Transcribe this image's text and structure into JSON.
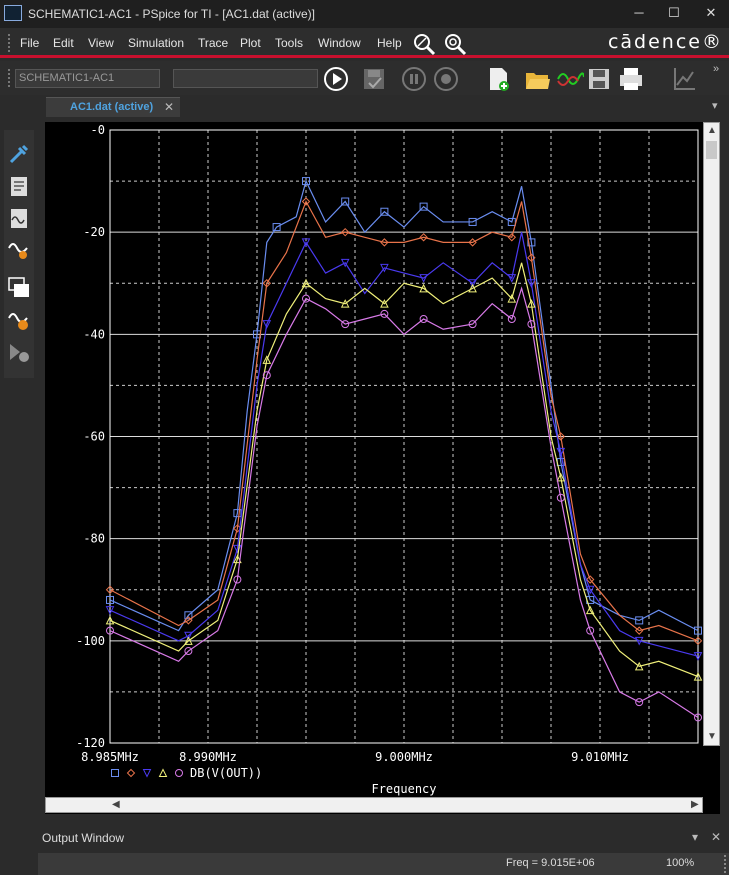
{
  "window": {
    "title": "SCHEMATIC1-AC1 - PSpice for TI - [AC1.dat (active)]",
    "minimize": "─",
    "maximize": "☐",
    "close": "✕"
  },
  "menu": {
    "items": [
      "File",
      "Edit",
      "View",
      "Simulation",
      "Trace",
      "Plot",
      "Tools",
      "Window",
      "Help"
    ],
    "brand": "cādence®"
  },
  "toolbar": {
    "profile_value": "SCHEMATIC1-AC1",
    "second_field_value": ""
  },
  "tabs": [
    {
      "label": "AC1.dat (active)",
      "close": "✕"
    }
  ],
  "output_window": {
    "title": "Output Window",
    "pin": "▾",
    "close": "✕"
  },
  "status": {
    "freq": "Freq = 9.015E+06",
    "zoom": "100%"
  },
  "colors": {
    "accent_red": "#c8102e",
    "tab_blue": "#4fa3e0"
  },
  "chart_data": {
    "type": "line",
    "xlabel": "Frequency",
    "ylabel": "",
    "x_ticks": [
      "8.985MHz",
      "8.990MHz",
      "9.000MHz",
      "9.010MHz"
    ],
    "y_ticks": [
      "-0",
      "-20",
      "-40",
      "-60",
      "-80",
      "-100",
      "-120"
    ],
    "ylim": [
      -120,
      0
    ],
    "xlim_mhz": [
      8.985,
      9.015
    ],
    "grid": true,
    "legend": {
      "label": "DB(V(OUT))",
      "markers": [
        "□",
        "◇",
        "▽",
        "△",
        "○"
      ]
    },
    "series": [
      {
        "marker": "square",
        "color": "#6a8df0",
        "x": [
          8.985,
          8.9885,
          8.989,
          8.9905,
          8.9915,
          8.992,
          8.9925,
          8.993,
          8.9935,
          8.9945,
          8.995,
          8.996,
          8.997,
          8.998,
          8.999,
          9.0,
          9.001,
          9.002,
          9.0035,
          9.0045,
          9.0055,
          9.006,
          9.0065,
          9.0075,
          9.008,
          9.009,
          9.0095,
          9.011,
          9.012,
          9.013,
          9.015
        ],
        "y": [
          -92,
          -98,
          -95,
          -90,
          -75,
          -55,
          -40,
          -22,
          -19,
          -17,
          -10,
          -18,
          -14,
          -20,
          -16,
          -19,
          -15,
          -18,
          -18,
          -16,
          -18,
          -11,
          -22,
          -50,
          -65,
          -85,
          -92,
          -95,
          -96,
          -94,
          -98
        ]
      },
      {
        "marker": "diamond",
        "color": "#e8734a",
        "x": [
          8.985,
          8.9885,
          8.989,
          8.9905,
          8.9915,
          8.9925,
          8.993,
          8.994,
          8.995,
          8.996,
          8.997,
          8.998,
          8.999,
          9.0,
          9.001,
          9.002,
          9.0035,
          9.0045,
          9.0055,
          9.006,
          9.0065,
          9.0075,
          9.008,
          9.009,
          9.0095,
          9.011,
          9.012,
          9.013,
          9.015
        ],
        "y": [
          -90,
          -97,
          -96,
          -92,
          -78,
          -45,
          -30,
          -24,
          -14,
          -21,
          -20,
          -21,
          -22,
          -22,
          -21,
          -22,
          -22,
          -20,
          -21,
          -14,
          -25,
          -52,
          -60,
          -83,
          -88,
          -95,
          -98,
          -97,
          -100
        ]
      },
      {
        "marker": "triangle-down",
        "color": "#4a3af0",
        "x": [
          8.985,
          8.9885,
          8.989,
          8.9905,
          8.9915,
          8.9925,
          8.993,
          8.994,
          8.995,
          8.996,
          8.997,
          8.998,
          8.999,
          9.0,
          9.001,
          9.002,
          9.0035,
          9.0045,
          9.0055,
          9.006,
          9.0065,
          9.0075,
          9.008,
          9.009,
          9.0095,
          9.011,
          9.012,
          9.013,
          9.015
        ],
        "y": [
          -94,
          -100,
          -99,
          -94,
          -82,
          -50,
          -38,
          -30,
          -22,
          -28,
          -26,
          -32,
          -27,
          -28,
          -29,
          -26,
          -30,
          -26,
          -29,
          -20,
          -30,
          -55,
          -63,
          -85,
          -90,
          -98,
          -100,
          -101,
          -103
        ]
      },
      {
        "marker": "triangle-up",
        "color": "#f0f07a",
        "x": [
          8.985,
          8.9885,
          8.989,
          8.9905,
          8.9915,
          8.9925,
          8.993,
          8.994,
          8.995,
          8.996,
          8.997,
          8.998,
          8.999,
          9.0,
          9.001,
          9.002,
          9.0035,
          9.0045,
          9.0055,
          9.006,
          9.0065,
          9.0075,
          9.008,
          9.009,
          9.0095,
          9.011,
          9.012,
          9.013,
          9.015
        ],
        "y": [
          -96,
          -102,
          -100,
          -96,
          -84,
          -55,
          -45,
          -36,
          -30,
          -33,
          -34,
          -31,
          -34,
          -30,
          -31,
          -34,
          -31,
          -29,
          -33,
          -26,
          -34,
          -60,
          -68,
          -88,
          -94,
          -102,
          -105,
          -104,
          -107
        ]
      },
      {
        "marker": "circle",
        "color": "#d87ae8",
        "x": [
          8.985,
          8.9885,
          8.989,
          8.9905,
          8.9915,
          8.9925,
          8.993,
          8.994,
          8.995,
          8.996,
          8.997,
          8.998,
          8.999,
          9.0,
          9.001,
          9.002,
          9.0035,
          9.0045,
          9.0055,
          9.006,
          9.0065,
          9.0075,
          9.008,
          9.009,
          9.0095,
          9.011,
          9.012,
          9.013,
          9.015
        ],
        "y": [
          -98,
          -104,
          -102,
          -98,
          -88,
          -58,
          -48,
          -40,
          -33,
          -35,
          -38,
          -37,
          -36,
          -40,
          -37,
          -39,
          -38,
          -34,
          -37,
          -31,
          -38,
          -62,
          -72,
          -92,
          -98,
          -110,
          -112,
          -110,
          -115
        ]
      }
    ]
  }
}
